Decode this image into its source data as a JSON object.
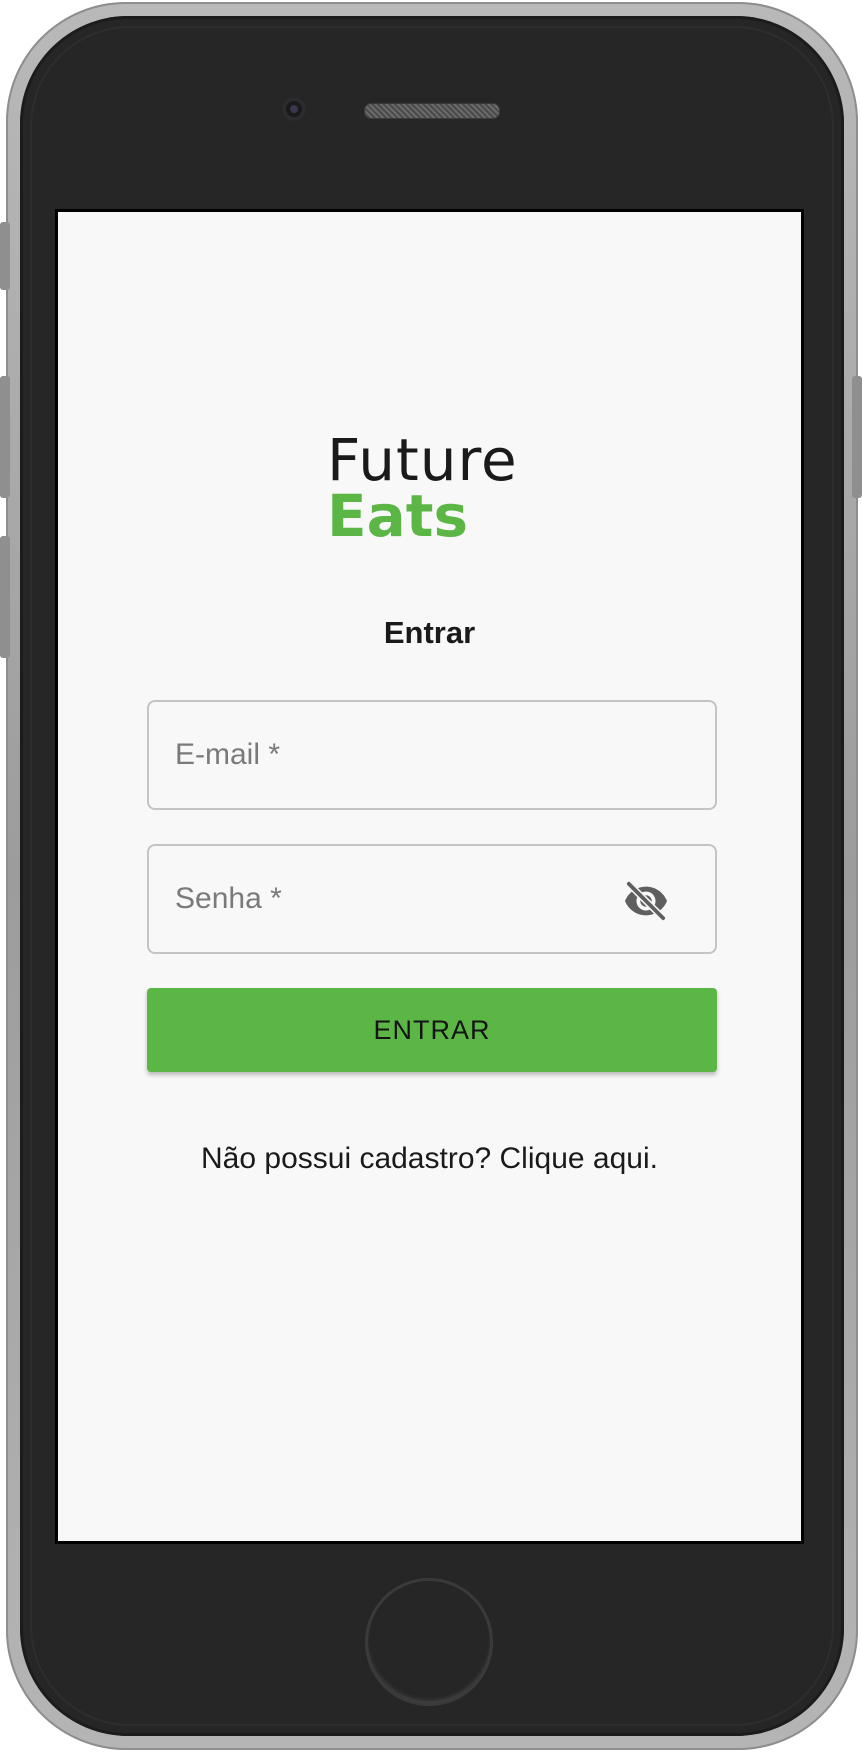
{
  "app": {
    "logo_line1": "Future",
    "logo_line2": "Eats",
    "brand_color": "#5cb646"
  },
  "login": {
    "title": "Entrar",
    "email_placeholder": "E-mail *",
    "password_placeholder": "Senha *",
    "toggle_visibility_icon": "eye-off-icon",
    "submit_label": "ENTRAR",
    "signup_text": "Não possui cadastro? Clique aqui."
  }
}
